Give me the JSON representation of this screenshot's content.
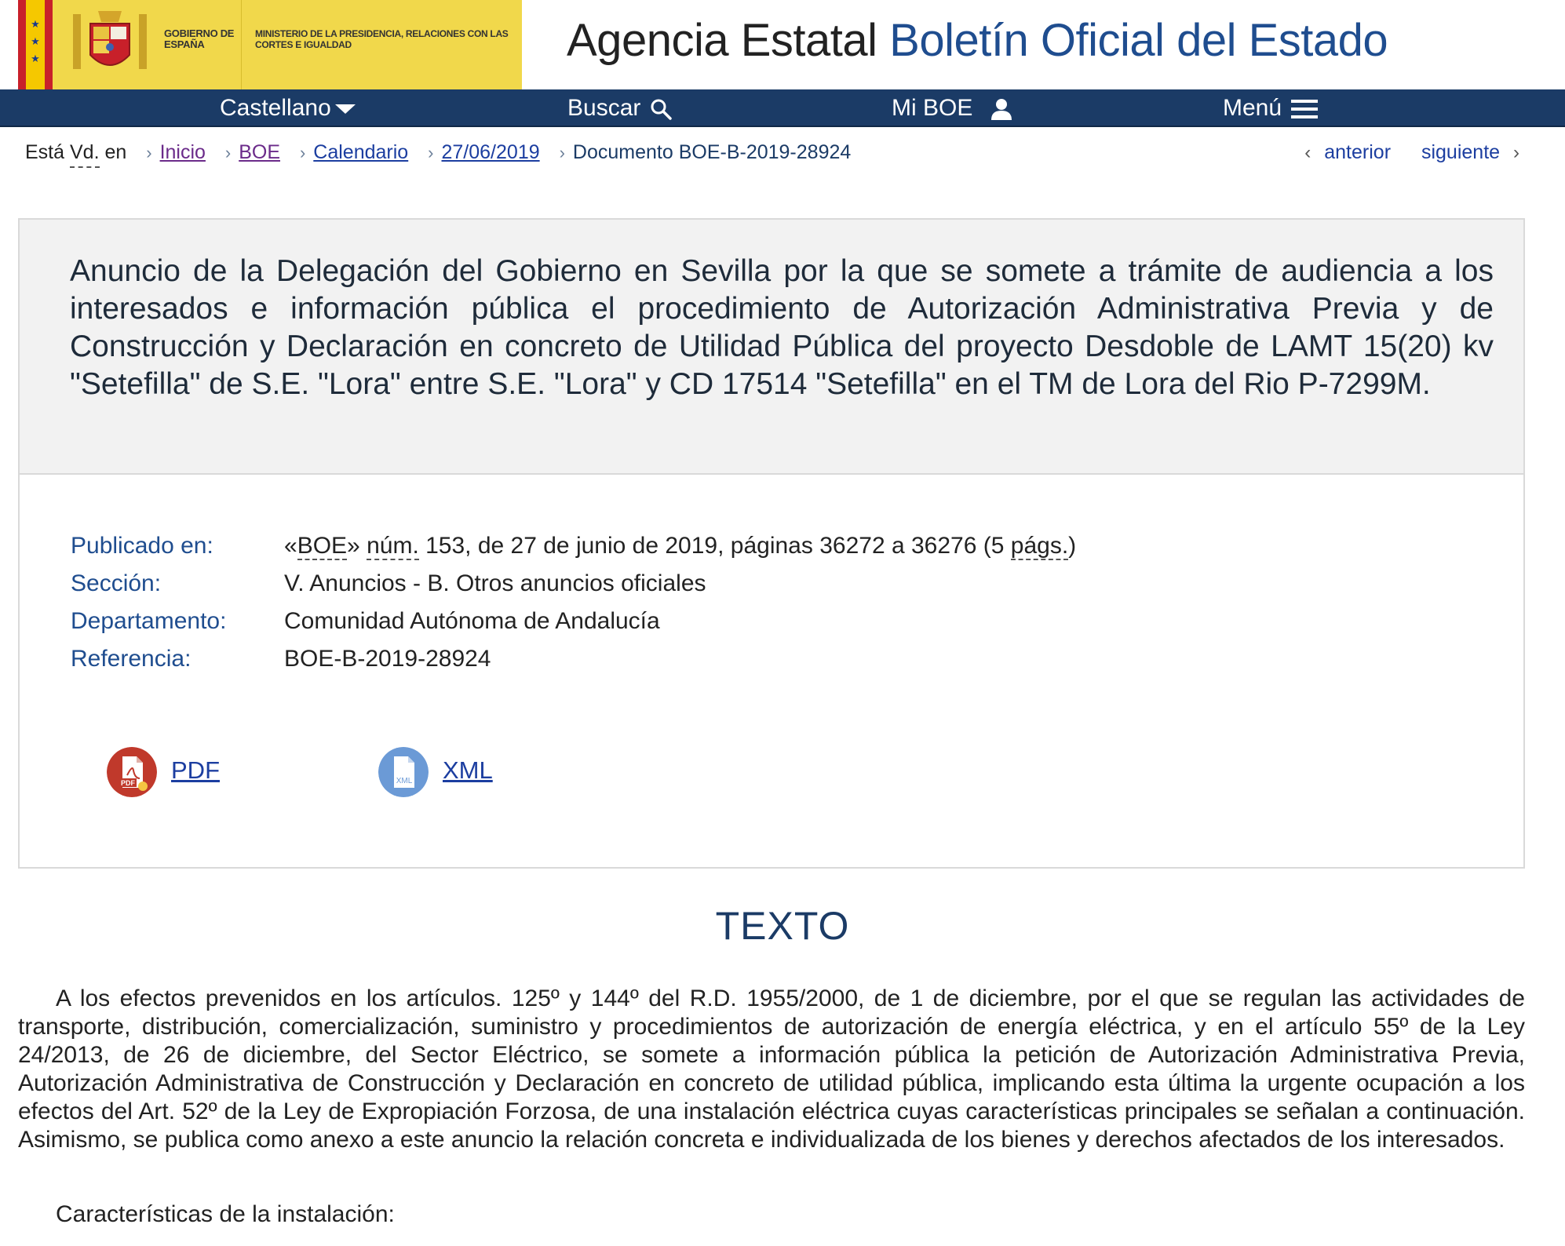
{
  "header": {
    "government_label": "GOBIERNO DE ESPAÑA",
    "ministry_label": "MINISTERIO DE LA PRESIDENCIA, RELACIONES CON LAS CORTES E IGUALDAD",
    "agency_prefix": "Agencia Estatal",
    "agency_name": "Boletín Oficial del Estado"
  },
  "nav": {
    "language": "Castellano",
    "search": "Buscar",
    "my_boe": "Mi BOE",
    "menu": "Menú"
  },
  "breadcrumb": {
    "intro_1": "Está",
    "intro_abbr": "Vd.",
    "intro_2": "en",
    "items": [
      "Inicio",
      "BOE",
      "Calendario",
      "27/06/2019"
    ],
    "current": "Documento BOE-B-2019-28924",
    "previous": "anterior",
    "next": "siguiente"
  },
  "document": {
    "title": "Anuncio de la Delegación del Gobierno en Sevilla por la que se somete a trámite de audiencia a los interesados e información pública el procedimiento de Autorización Administrativa Previa y de Construcción y Declaración en concreto de Utilidad Pública del proyecto Desdoble de LAMT 15(20) kv \"Setefilla\" de S.E. \"Lora\" entre S.E. \"Lora\" y CD 17514 \"Setefilla\" en el TM de Lora del Rio P-7299M.",
    "metadata": {
      "published_label": "Publicado en:",
      "published_pre": "«",
      "published_boe": "BOE",
      "published_mid1": "» ",
      "published_num": "núm.",
      "published_mid2": " 153, de 27 de junio de 2019, páginas 36272 a 36276 (5 ",
      "published_pags": "págs.",
      "published_end": ")",
      "section_label": "Sección:",
      "section_value": "V. Anuncios - B. Otros anuncios oficiales",
      "department_label": "Departamento:",
      "department_value": "Comunidad Autónoma de Andalucía",
      "reference_label": "Referencia:",
      "reference_value": "BOE-B-2019-28924"
    },
    "downloads": {
      "pdf_label": "PDF",
      "xml_label": "XML"
    }
  },
  "texto": {
    "heading": "TEXTO",
    "paragraph": "A los efectos prevenidos en los artículos. 125º y 144º del R.D. 1955/2000, de 1 de diciembre, por el que se regulan las actividades de transporte, distribución, comercialización, suministro y procedimientos de autorización de energía eléctrica, y en el artículo 55º de la Ley 24/2013, de 26 de diciembre, del Sector Eléctrico, se somete a información pública la petición de Autorización Administrativa Previa, Autorización Administrativa de Construcción y Declaración en concreto de utilidad pública, implicando esta última la urgente ocupación a los efectos del Art. 52º de la Ley de Expropiación Forzosa, de una instalación eléctrica cuyas características principales se señalan a continuación. Asimismo, se publica como anexo a este anuncio la relación concreta e individualizada de los bienes y derechos afectados de los interesados.",
    "subheading": "Características de la instalación:"
  },
  "colors": {
    "navbar": "#1b3b66",
    "link": "#1c3ea0",
    "visited_link": "#6b2b8a",
    "meta_label": "#1f4d8f",
    "logo_yellow": "#f1d84b",
    "title_box": "#f2f2f2"
  }
}
